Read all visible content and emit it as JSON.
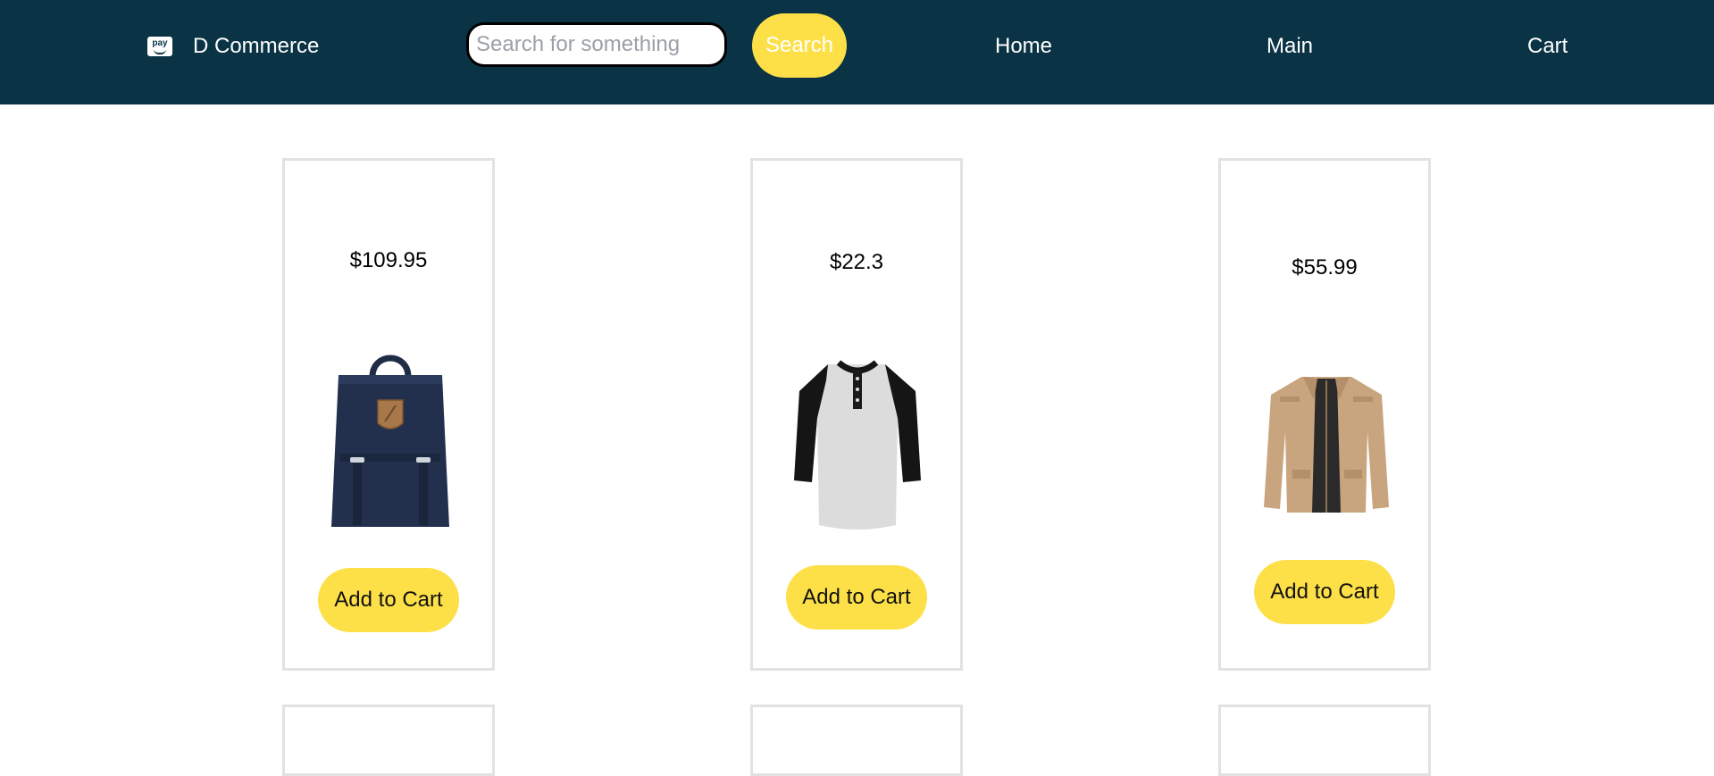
{
  "header": {
    "brand_icon_text": "pay",
    "brand_name": "D Commerce",
    "search_placeholder": "Search for something",
    "search_value": "",
    "search_button": "Search",
    "nav": [
      "Home",
      "Main",
      "Cart"
    ]
  },
  "products": [
    {
      "price": "$109.95",
      "add_label": "Add to Cart",
      "icon": "backpack-image"
    },
    {
      "price": "$22.3",
      "add_label": "Add to Cart",
      "icon": "henley-shirt-image"
    },
    {
      "price": "$55.99",
      "add_label": "Add to Cart",
      "icon": "jacket-image"
    }
  ],
  "colors": {
    "nav_bg": "#0b3346",
    "accent": "#fde047",
    "card_border": "#e2e2e2"
  }
}
